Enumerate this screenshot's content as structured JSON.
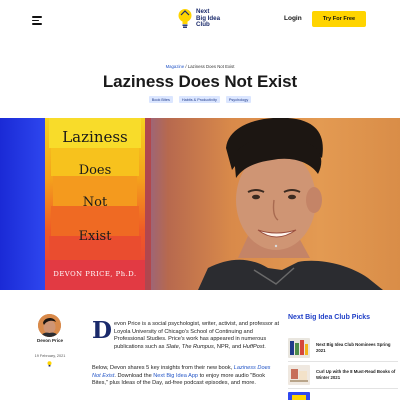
{
  "header": {
    "logo_lines": [
      "Next",
      "Big Idea",
      "Club"
    ],
    "login_label": "Login",
    "try_label": "Try For Free"
  },
  "breadcrumb": {
    "section": "Magazine",
    "separator": "/",
    "current": "Laziness Does Not Exist"
  },
  "article": {
    "title": "Laziness Does Not Exist",
    "tags": [
      "Book Bites",
      "Habits & Productivity",
      "Psychology"
    ],
    "book_cover": {
      "words": [
        "Laziness",
        "Does",
        "Not",
        "Exist"
      ],
      "author": "DEVON PRICE, Ph.D."
    },
    "author": {
      "name": "Devon Price",
      "date": "19 February, 2021"
    },
    "drop_cap": "D",
    "para1": {
      "lead": "evon Price is a social psychologist, writer, activist, and professor at Loyola University of Chicago's School of Continuing and Professional Studies. Price's work has appeared in numerous publications such as ",
      "pub1": "Slate",
      "sep1": ", ",
      "pub2": "The Rumpus",
      "sep2": ", NPR, and ",
      "pub3": "HuffPost",
      "end": "."
    },
    "para2": {
      "lead": "Below, Devon shares 5 key insights from their new book, ",
      "book_link": "Laziness Does Not Exist",
      "mid": ". Download the ",
      "app_link": "Next Big Idea App",
      "tail": " to enjoy more audio \"Book Bites,\" plus Ideas of the Day, ad-free podcast episodes, and more."
    }
  },
  "sidebar": {
    "title": "Next Big Idea Club Picks",
    "items": [
      {
        "title": "Next Big Idea Club Nominees Spring 2021"
      },
      {
        "title": "Curl Up with the 8 Must-Read Books of Winter 2021"
      }
    ]
  },
  "colors": {
    "accent_yellow": "#ffd400",
    "brand_navy": "#1a2a6b",
    "link_blue": "#2456c7",
    "hero_blue": "#2f48f0",
    "hero_orange": "#e39a52"
  }
}
